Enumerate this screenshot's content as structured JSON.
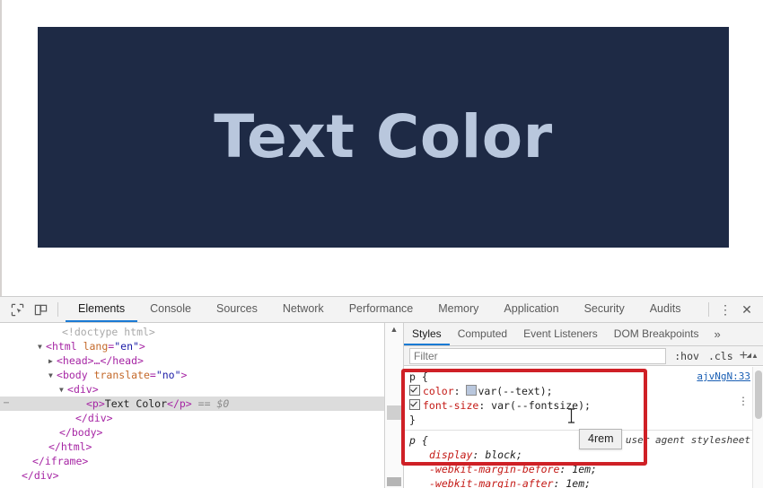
{
  "page": {
    "hero_text": "Text Color",
    "hero_bg": "#1e2a45",
    "hero_color": "#b9c7dd"
  },
  "devtools": {
    "toolbar_icons": [
      {
        "name": "inspect-element-icon"
      },
      {
        "name": "device-toolbar-icon"
      }
    ],
    "tabs": [
      {
        "label": "Elements",
        "active": true
      },
      {
        "label": "Console",
        "active": false
      },
      {
        "label": "Sources",
        "active": false
      },
      {
        "label": "Network",
        "active": false
      },
      {
        "label": "Performance",
        "active": false
      },
      {
        "label": "Memory",
        "active": false
      },
      {
        "label": "Application",
        "active": false
      },
      {
        "label": "Security",
        "active": false
      },
      {
        "label": "Audits",
        "active": false
      }
    ],
    "more_menu_glyph": "⋮",
    "close_glyph": "✕",
    "accent_color": "#1a7ad4"
  },
  "dom_tree": {
    "rows": [
      {
        "indent": 60,
        "triangle": "",
        "text": "<!doctype html>",
        "kind": "doctype",
        "selected": false,
        "dots": false
      },
      {
        "indent": 48,
        "triangle": "▼",
        "kind": "open",
        "tag": "html",
        "attr": "lang",
        "attrval": "\"en\"",
        "selected": false,
        "dots": false
      },
      {
        "indent": 60,
        "triangle": "▶",
        "kind": "collapsed",
        "text": "<head>…</head>",
        "selected": false,
        "dots": false
      },
      {
        "indent": 60,
        "triangle": "▼",
        "kind": "open",
        "tag": "body",
        "attr": "translate",
        "attrval": "\"no\"",
        "selected": false,
        "dots": false
      },
      {
        "indent": 72,
        "triangle": "▼",
        "kind": "open",
        "tag": "div",
        "attr": "",
        "attrval": "",
        "selected": false,
        "dots": false
      },
      {
        "indent": 96,
        "triangle": "",
        "kind": "text-node",
        "open_tag": "<p>",
        "node_text": "Text Color",
        "close_tag": "</p>",
        "suffix": "== $0",
        "selected": true,
        "dots": true
      },
      {
        "indent": 84,
        "triangle": "",
        "kind": "close",
        "text": "</div>",
        "selected": false,
        "dots": false
      },
      {
        "indent": 72,
        "triangle": "",
        "kind": "close",
        "text": "</body>",
        "selected": false,
        "dots": false
      },
      {
        "indent": 60,
        "triangle": "",
        "kind": "close",
        "text": "</html>",
        "selected": false,
        "dots": false
      },
      {
        "indent": 42,
        "triangle": "",
        "kind": "close",
        "text": "</iframe>",
        "selected": false,
        "dots": false
      },
      {
        "indent": 30,
        "triangle": "",
        "kind": "close",
        "text": "</div>",
        "selected": false,
        "dots": false
      }
    ]
  },
  "styles": {
    "tabs": [
      {
        "label": "Styles",
        "active": true
      },
      {
        "label": "Computed",
        "active": false
      },
      {
        "label": "Event Listeners",
        "active": false
      },
      {
        "label": "DOM Breakpoints",
        "active": false
      }
    ],
    "more_glyph": "»",
    "filter": {
      "placeholder": "Filter",
      "value": ""
    },
    "hov_label": ":hov",
    "cls_label": ".cls",
    "plus_label": "+",
    "rules": [
      {
        "selector": "p {",
        "origin": "ajvNgN:33",
        "origin_is_link": true,
        "closing": "}",
        "declarations": [
          {
            "checkbox": true,
            "property": "color",
            "value": "var(--text);",
            "swatch": "#b9c7dd"
          },
          {
            "checkbox": true,
            "property": "font-size",
            "value": "var(--fontsize);",
            "swatch": null
          }
        ]
      },
      {
        "selector": "p {",
        "origin": "user agent stylesheet",
        "origin_is_link": false,
        "closing": "",
        "declarations": [
          {
            "checkbox": false,
            "property": "display",
            "value": "block;",
            "swatch": null
          },
          {
            "checkbox": false,
            "property": "-webkit-margin-before",
            "value": "1em;",
            "swatch": null
          },
          {
            "checkbox": false,
            "property": "-webkit-margin-after",
            "value": "1em;",
            "swatch": null
          }
        ]
      }
    ]
  },
  "annotations": {
    "highlight_color": "#cf2026",
    "tooltip_text": "4rem"
  }
}
